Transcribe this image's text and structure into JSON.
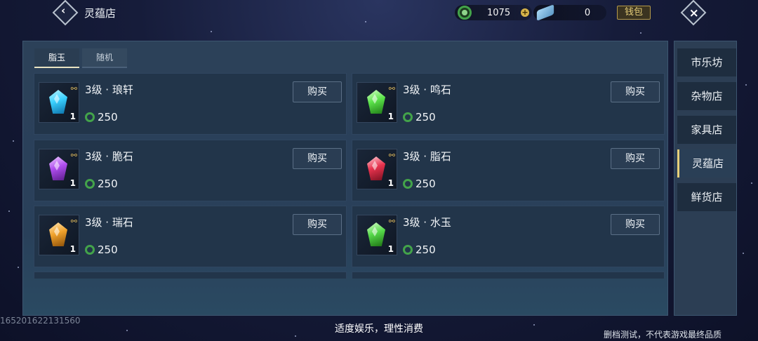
{
  "header": {
    "title": "灵蕴店",
    "currency_1": {
      "icon": "jade-coin-icon",
      "value": "1075"
    },
    "currency_2": {
      "icon": "crystal-icon",
      "value": "0"
    },
    "wallet_label": "钱包"
  },
  "tabs": [
    {
      "label": "脂玉",
      "active": true
    },
    {
      "label": "随机",
      "active": false
    }
  ],
  "items": [
    {
      "name": "3级 · 琅轩",
      "qty": "1",
      "price": "250",
      "color": "#3ad1ff",
      "buy_label": "购买"
    },
    {
      "name": "3级 · 鸣石",
      "qty": "1",
      "price": "250",
      "color": "#5be34a",
      "buy_label": "购买"
    },
    {
      "name": "3级 · 脆石",
      "qty": "1",
      "price": "250",
      "color": "#b04ef0",
      "buy_label": "购买"
    },
    {
      "name": "3级 · 脂石",
      "qty": "1",
      "price": "250",
      "color": "#e8334e",
      "buy_label": "购买"
    },
    {
      "name": "3级 · 瑞石",
      "qty": "1",
      "price": "250",
      "color": "#f0a22c",
      "buy_label": "购买"
    },
    {
      "name": "3级 · 水玉",
      "qty": "1",
      "price": "250",
      "color": "#56d94a",
      "buy_label": "购买"
    }
  ],
  "sidenav": [
    {
      "label": "市乐坊",
      "active": false
    },
    {
      "label": "杂物店",
      "active": false
    },
    {
      "label": "家具店",
      "active": false
    },
    {
      "label": "灵蕴店",
      "active": true
    },
    {
      "label": "鲜货店",
      "active": false
    }
  ],
  "footer": {
    "slogan": "适度娱乐，理性消费",
    "notice": "删档测试，不代表游戏最终品质",
    "build_id": "165201622131560"
  }
}
